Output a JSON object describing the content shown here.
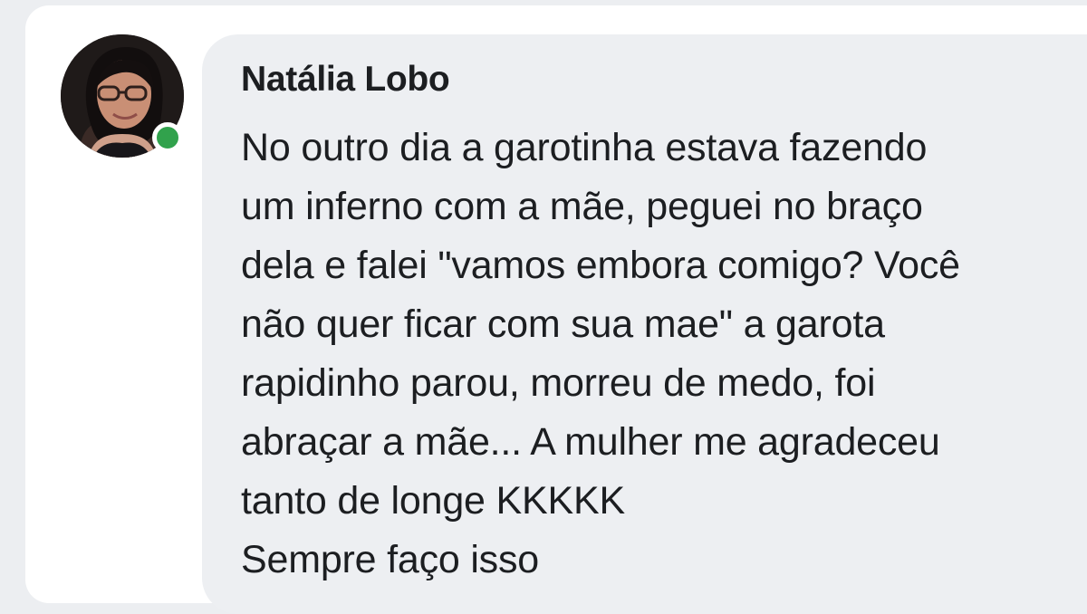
{
  "comment": {
    "author_name": "Natália Lobo",
    "online_status": "online",
    "avatar_icon": "user-profile-photo",
    "status_color": "#31a24c",
    "text_lines": [
      "No outro dia a garotinha estava fazendo",
      "um inferno com a mãe, peguei no braço",
      "dela e falei \"vamos embora comigo? Você",
      "não quer ficar com sua mae\" a garota",
      "rapidinho parou, morreu de medo, foi",
      "abraçar a mãe... A mulher me agradeceu",
      "tanto de longe KKKKK",
      "Sempre faço isso"
    ]
  }
}
